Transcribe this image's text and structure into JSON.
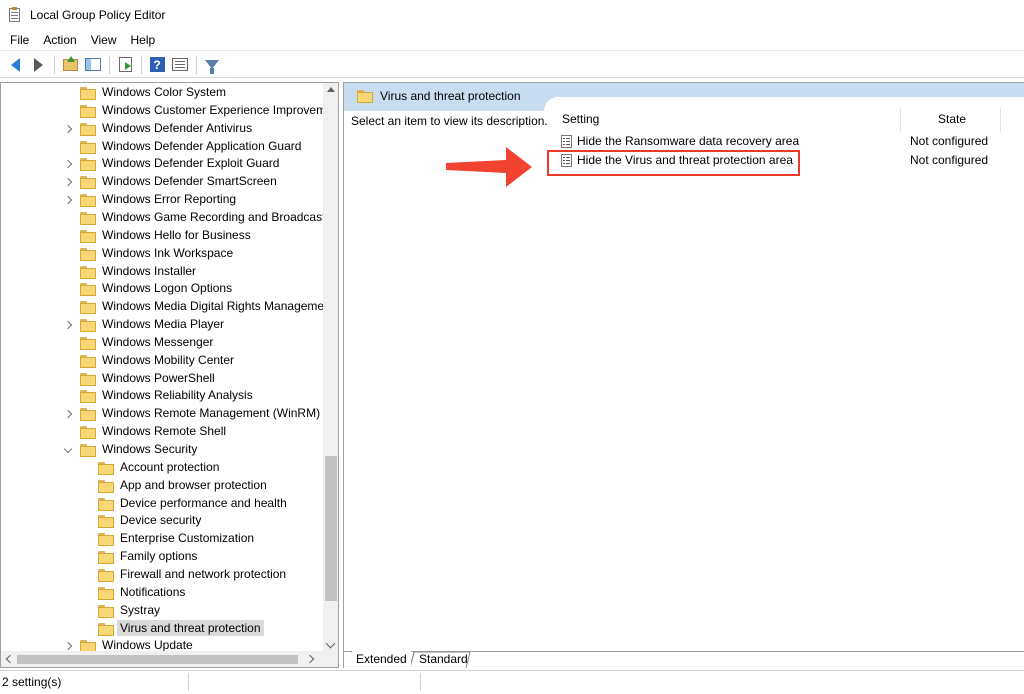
{
  "window": {
    "title": "Local Group Policy Editor"
  },
  "menu": [
    "File",
    "Action",
    "View",
    "Help"
  ],
  "toolbar": {
    "icons": [
      "back-arrow-icon",
      "forward-arrow-icon",
      "up-folder-icon",
      "show-hide-tree-icon",
      "export-list-icon",
      "help-icon",
      "properties-icon",
      "filter-icon"
    ]
  },
  "tree": {
    "items": [
      {
        "label": "Windows Color System",
        "level": 0,
        "expander": "none"
      },
      {
        "label": "Windows Customer Experience Improvem",
        "level": 0,
        "expander": "none"
      },
      {
        "label": "Windows Defender Antivirus",
        "level": 0,
        "expander": "collapsed"
      },
      {
        "label": "Windows Defender Application Guard",
        "level": 0,
        "expander": "none"
      },
      {
        "label": "Windows Defender Exploit Guard",
        "level": 0,
        "expander": "collapsed"
      },
      {
        "label": "Windows Defender SmartScreen",
        "level": 0,
        "expander": "collapsed"
      },
      {
        "label": "Windows Error Reporting",
        "level": 0,
        "expander": "collapsed"
      },
      {
        "label": "Windows Game Recording and Broadcastii",
        "level": 0,
        "expander": "none"
      },
      {
        "label": "Windows Hello for Business",
        "level": 0,
        "expander": "none"
      },
      {
        "label": "Windows Ink Workspace",
        "level": 0,
        "expander": "none"
      },
      {
        "label": "Windows Installer",
        "level": 0,
        "expander": "none"
      },
      {
        "label": "Windows Logon Options",
        "level": 0,
        "expander": "none"
      },
      {
        "label": "Windows Media Digital Rights Manageme",
        "level": 0,
        "expander": "none"
      },
      {
        "label": "Windows Media Player",
        "level": 0,
        "expander": "collapsed"
      },
      {
        "label": "Windows Messenger",
        "level": 0,
        "expander": "none"
      },
      {
        "label": "Windows Mobility Center",
        "level": 0,
        "expander": "none"
      },
      {
        "label": "Windows PowerShell",
        "level": 0,
        "expander": "none"
      },
      {
        "label": "Windows Reliability Analysis",
        "level": 0,
        "expander": "none"
      },
      {
        "label": "Windows Remote Management (WinRM)",
        "level": 0,
        "expander": "collapsed"
      },
      {
        "label": "Windows Remote Shell",
        "level": 0,
        "expander": "none"
      },
      {
        "label": "Windows Security",
        "level": 0,
        "expander": "expanded"
      },
      {
        "label": "Account protection",
        "level": 1,
        "expander": "none"
      },
      {
        "label": "App and browser protection",
        "level": 1,
        "expander": "none"
      },
      {
        "label": "Device performance and health",
        "level": 1,
        "expander": "none"
      },
      {
        "label": "Device security",
        "level": 1,
        "expander": "none"
      },
      {
        "label": "Enterprise Customization",
        "level": 1,
        "expander": "none"
      },
      {
        "label": "Family options",
        "level": 1,
        "expander": "none"
      },
      {
        "label": "Firewall and network protection",
        "level": 1,
        "expander": "none"
      },
      {
        "label": "Notifications",
        "level": 1,
        "expander": "none"
      },
      {
        "label": "Systray",
        "level": 1,
        "expander": "none"
      },
      {
        "label": "Virus and threat protection",
        "level": 1,
        "expander": "none",
        "selected": true
      },
      {
        "label": "Windows Update",
        "level": 0,
        "expander": "collapsed"
      }
    ]
  },
  "details": {
    "header_title": "Virus and threat protection",
    "description": "Select an item to view its description.",
    "columns": {
      "setting": "Setting",
      "state": "State"
    },
    "rows": [
      {
        "name": "Hide the Ransomware data recovery area",
        "state": "Not configured"
      },
      {
        "name": "Hide the Virus and threat protection area",
        "state": "Not configured",
        "highlighted": true
      }
    ],
    "tabs": [
      "Extended",
      "Standard"
    ],
    "active_tab": "Extended"
  },
  "status": {
    "text": "2 setting(s)"
  },
  "colors": {
    "header_band": "#c9ddf1",
    "highlight": "#e8392a",
    "selected_row": "#d9d9d9"
  }
}
